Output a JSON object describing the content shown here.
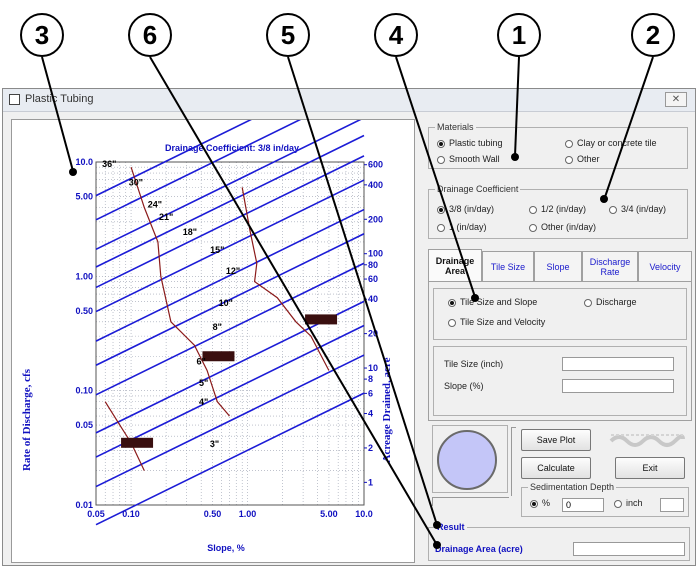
{
  "callouts": [
    "3",
    "6",
    "5",
    "4",
    "1",
    "2"
  ],
  "window": {
    "title": "Plastic Tubing",
    "close_glyph": "✕"
  },
  "chart_data": {
    "type": "line",
    "title": "Drainage Coefficient: 3/8 in/day",
    "xlabel": "Slope, %",
    "ylabel_left": "Rate of Discharge, cfs",
    "ylabel_right": "Acreage Drained, acre",
    "x_scale": "log",
    "y_scale": "log",
    "xlim": [
      0.05,
      10.0
    ],
    "ylim": [
      0.01,
      10.0
    ],
    "grid": true,
    "x_ticks": [
      "0.05",
      "0.10",
      "0.50",
      "1.00",
      "5.00",
      "10.0"
    ],
    "y_ticks": [
      "0.01",
      "0.05",
      "0.10",
      "0.50",
      "1.00",
      "5.00",
      "10.0"
    ],
    "acre_ticks": [
      "600",
      "400",
      "200",
      "100",
      "80",
      "60",
      "40",
      "20",
      "10",
      "8",
      "6",
      "4",
      "2",
      "1"
    ],
    "tile_sizes": [
      "36\"",
      "30\"",
      "24\"",
      "21\"",
      "18\"",
      "15\"",
      "12\"",
      "10\"",
      "8\"",
      "6\"",
      "5\"",
      "4\"",
      "3\""
    ],
    "tile_diameters_in": [
      36,
      30,
      24,
      21,
      18,
      15,
      12,
      10,
      8,
      6,
      5,
      4,
      3
    ],
    "colors": {
      "tile_lines": "#1c1cd6",
      "velocity_curves": "#8b1a1a",
      "grid": "#9aa0b0",
      "axis_text": "#1010c0"
    }
  },
  "materials": {
    "legend": "Materials",
    "options": [
      {
        "label": "Plastic tubing",
        "selected": true
      },
      {
        "label": "Clay or concrete tile",
        "selected": false
      },
      {
        "label": "Smooth Wall",
        "selected": false
      },
      {
        "label": "Other",
        "selected": false
      }
    ]
  },
  "drainage_coefficient": {
    "legend": "Drainage Coefficient",
    "options": [
      {
        "label": "3/8 (in/day)",
        "selected": true
      },
      {
        "label": "1/2 (in/day)",
        "selected": false
      },
      {
        "label": "3/4 (in/day)",
        "selected": false
      },
      {
        "label": "1 (in/day)",
        "selected": false
      },
      {
        "label": "Other (in/day)",
        "selected": false
      }
    ]
  },
  "tabs": [
    "Drainage Area",
    "Tile Size",
    "Slope",
    "Discharge Rate",
    "Velocity"
  ],
  "drainage_area_tab": {
    "options": [
      {
        "label": "Tile Size and Slope",
        "selected": true
      },
      {
        "label": "Discharge",
        "selected": false
      },
      {
        "label": "Tile Size and Velocity",
        "selected": false
      }
    ],
    "tile_size_label": "Tile Size (inch)",
    "slope_label": "Slope (%)"
  },
  "buttons": {
    "save": "Save Plot",
    "calculate": "Calculate",
    "exit": "Exit"
  },
  "sedimentation": {
    "legend": "Sedimentation Depth",
    "pct_label": "%",
    "value": "0",
    "inch_label": "inch",
    "pct_selected": true
  },
  "result": {
    "legend": "Result",
    "label": "Drainage Area (acre)",
    "value": ""
  }
}
